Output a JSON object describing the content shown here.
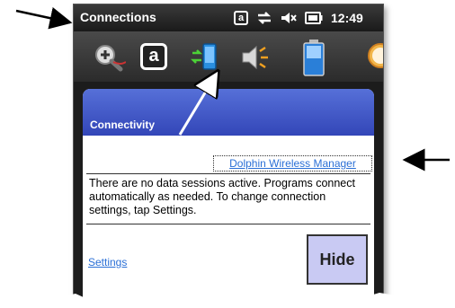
{
  "window": {
    "title": "Connections"
  },
  "status": {
    "a_icon": "a",
    "time": "12:49"
  },
  "icons": [
    "zoom-icon",
    "a-icon",
    "connectivity-icon",
    "volume-icon",
    "battery-icon",
    "clock-icon"
  ],
  "iconbar": {
    "a_label": "a"
  },
  "popup": {
    "title": "Connectivity",
    "wireless_link": "Dolphin Wireless Manager",
    "message": "There are no data sessions active. Programs connect automatically as needed. To change connection settings, tap Settings.",
    "settings_link": "Settings",
    "hide_label": "Hide"
  },
  "colors": {
    "header_blue": "#3f55c6",
    "link_blue": "#2a6fd6",
    "hide_bg": "#c9caf3"
  }
}
